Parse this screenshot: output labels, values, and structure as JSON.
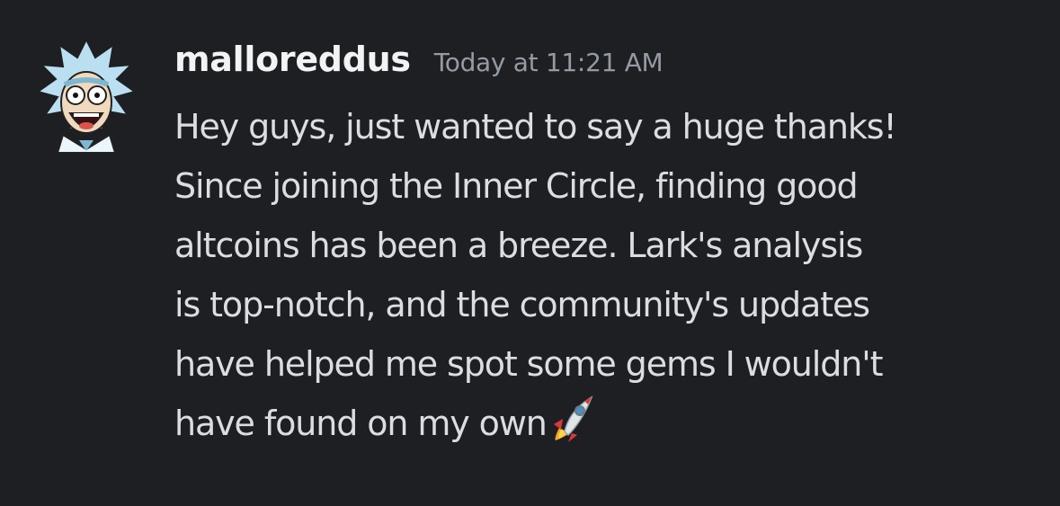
{
  "message": {
    "username": "malloreddus",
    "timestamp": "Today at 11:21 AM",
    "avatar": "rick-character-avatar",
    "lines": [
      "Hey guys, just wanted to say a huge thanks!",
      "Since joining the Inner Circle, finding good",
      "altcoins has been a breeze. Lark's analysis",
      "is top-notch, and the community's updates",
      "have helped me spot some gems I wouldn't",
      "have found on my own"
    ],
    "emoji": "rocket-emoji"
  },
  "colors": {
    "background": "#1e1f22",
    "username": "#f2f3f5",
    "timestamp": "#949ba4",
    "text": "#dbdee1"
  }
}
